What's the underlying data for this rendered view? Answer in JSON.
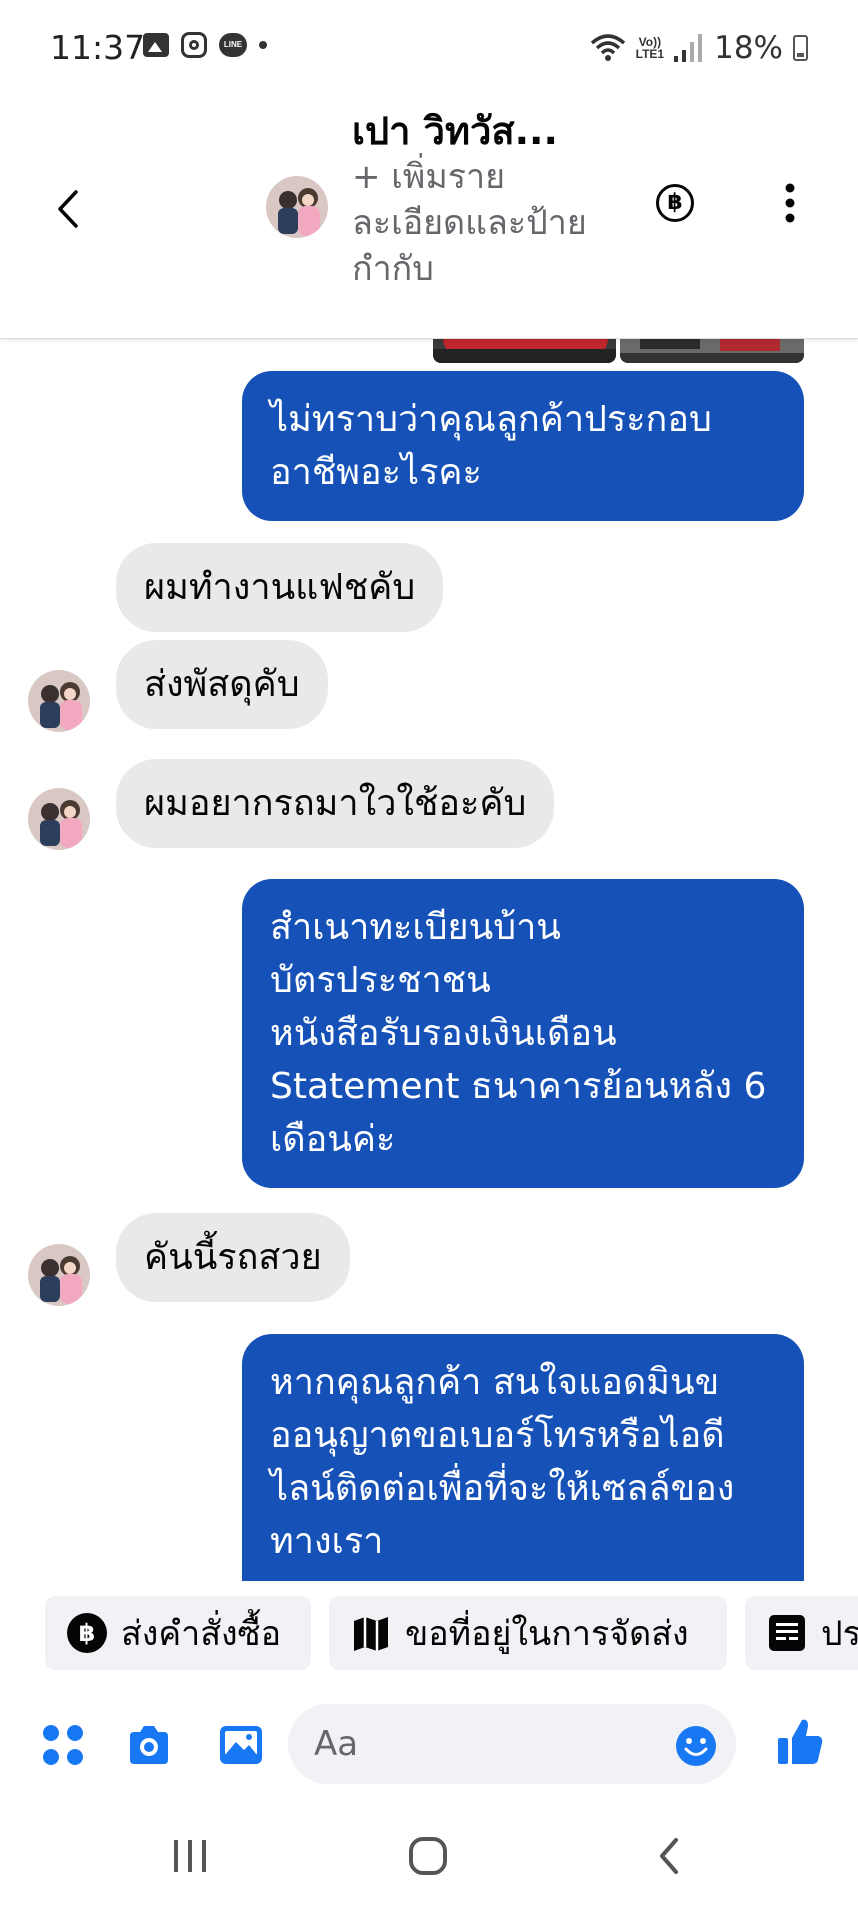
{
  "status_bar": {
    "time": "11:37",
    "icons": [
      "gallery-icon",
      "instagram-icon",
      "line-icon",
      "dot-icon"
    ],
    "volte_top": "Vo))",
    "volte_bottom": "LTE1",
    "battery": "18%"
  },
  "header": {
    "contact_name": "เปา วิทวัส...",
    "subtitle": "+ เพิ่มราย\nละเอียดและป้าย\nกำกับ",
    "baht_symbol": "฿"
  },
  "messages": [
    {
      "sender": "agent",
      "lines": [
        "ไม่ทราบว่าคุณลูกค้าประกอบ",
        "อาชีพอะไรคะ"
      ]
    },
    {
      "sender": "customer",
      "lines": [
        "ผมทำงานแฟชคับ"
      ]
    },
    {
      "sender": "customer",
      "lines": [
        "ส่งพัสดุคับ"
      ]
    },
    {
      "sender": "customer",
      "lines": [
        "ผมอยากรถมาใวใช้อะคับ"
      ]
    },
    {
      "sender": "agent",
      "lines": [
        "สำเนาทะเบียนบ้าน",
        "บัตรประชาชน",
        "หนังสือรับรองเงินเดือน",
        "Statement ธนาคารย้อนหลัง 6",
        "เดือนค่ะ"
      ]
    },
    {
      "sender": "customer",
      "lines": [
        "คันนี้รถสวย"
      ]
    },
    {
      "sender": "agent",
      "lines": [
        "หากคุณลูกค้า สนใจแอดมินข",
        "ออนุญาตขอเบอร์โทรหรือไอดี",
        "ไลน์ติดต่อเพื่อที่จะให้เซลล์ของ",
        "ทางเรา"
      ]
    }
  ],
  "quick_replies": [
    {
      "label": "ส่งคำสั่งซื้อ",
      "icon": "baht-icon"
    },
    {
      "label": "ขอที่อยู่ในการจัดส่ง",
      "icon": "map-icon"
    },
    {
      "label": "ปร",
      "icon": "receipt-icon"
    }
  ],
  "composer": {
    "placeholder": "Aa"
  },
  "colors": {
    "outgoing_bubble": "#1551b6",
    "incoming_bubble": "#e9e9e9",
    "accent": "#1877f2"
  }
}
